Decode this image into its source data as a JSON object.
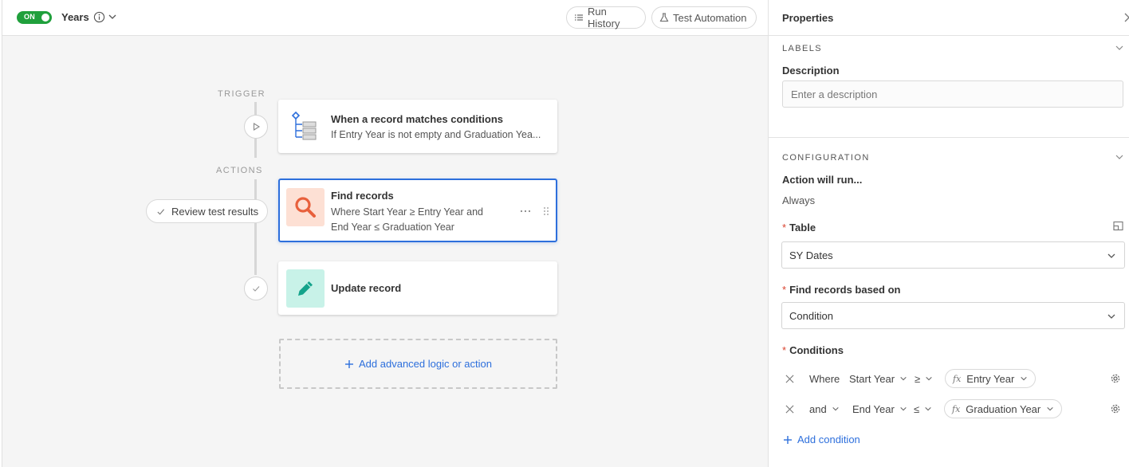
{
  "topbar": {
    "toggle_label": "ON",
    "automation_name": "Years",
    "run_history_label": "Run History",
    "test_automation_label": "Test Automation"
  },
  "flow": {
    "trigger_label": "TRIGGER",
    "actions_label": "ACTIONS",
    "trigger_card": {
      "title": "When a record matches conditions",
      "subtitle": "If Entry Year is not empty and Graduation Yea..."
    },
    "find_card": {
      "title": "Find records",
      "subtitle_line1": "Where Start Year ≥ Entry Year and",
      "subtitle_line2": "End Year ≤ Graduation Year",
      "icon_bg": "#fde0d4",
      "icon_color": "#e8603c"
    },
    "update_card": {
      "title": "Update record",
      "icon_bg": "#c8f2e8",
      "icon_color": "#14a38b"
    },
    "review_label": "Review test results",
    "add_logic_label": "Add advanced logic or action"
  },
  "panel": {
    "title": "Properties",
    "labels_section": "LABELS",
    "description_label": "Description",
    "description_placeholder": "Enter a description",
    "description_value": "",
    "configuration_section": "CONFIGURATION",
    "action_runs_label": "Action will run...",
    "action_runs_value": "Always",
    "table_label": "Table",
    "table_value": "SY Dates",
    "find_based_label": "Find records based on",
    "find_based_value": "Condition",
    "conditions_label": "Conditions",
    "conditions": [
      {
        "conjunction": "Where",
        "field": "Start Year",
        "operator": "≥",
        "value_field": "Entry Year"
      },
      {
        "conjunction": "and",
        "field": "End Year",
        "operator": "≤",
        "value_field": "Graduation Year"
      }
    ],
    "add_condition_label": "Add condition"
  },
  "colors": {
    "accent": "#2d6fdc",
    "toggle_on": "#20a03c",
    "required": "#d9432f"
  }
}
